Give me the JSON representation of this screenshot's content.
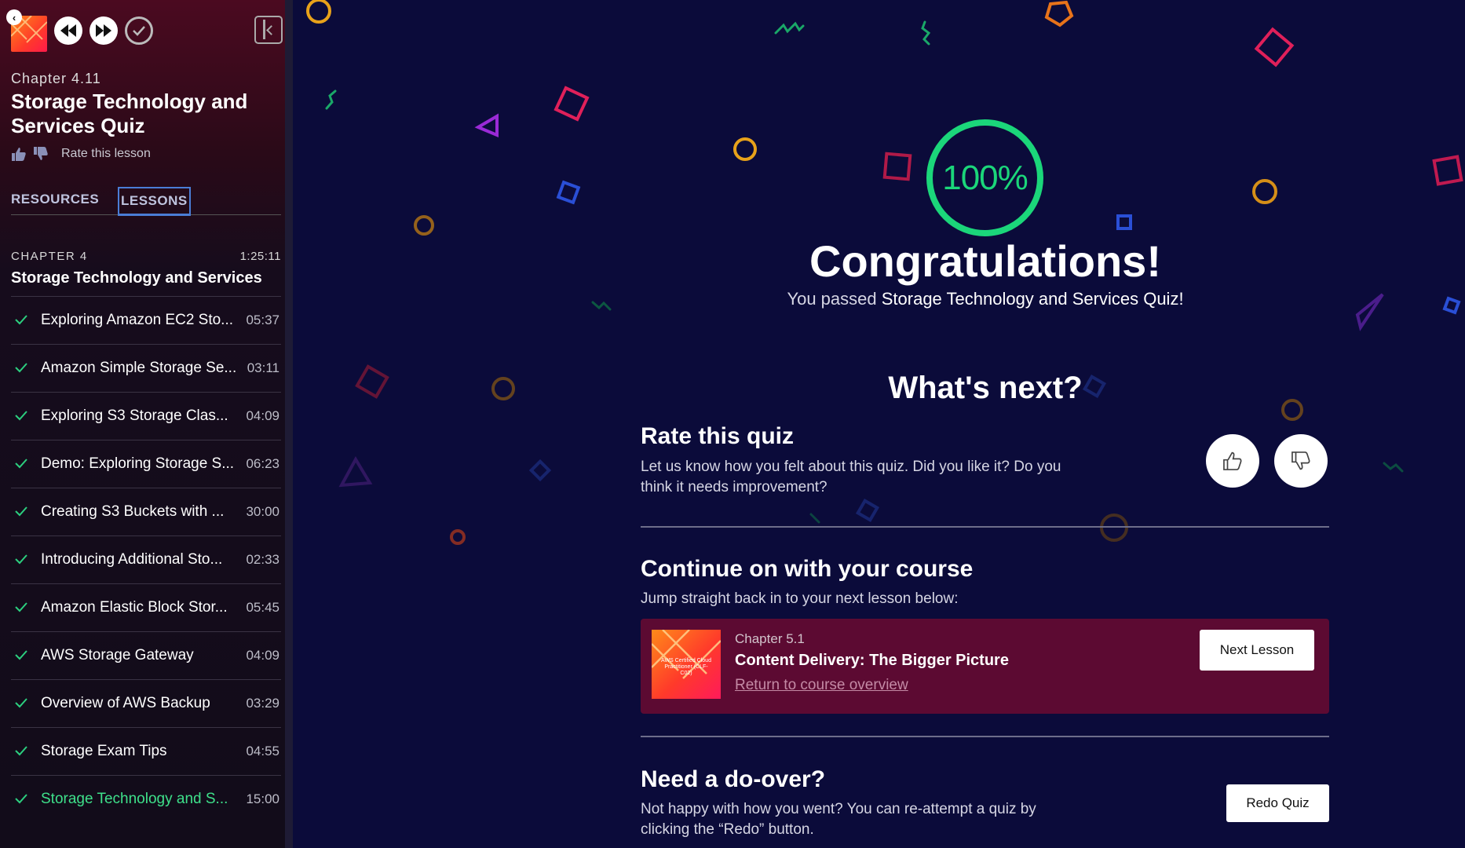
{
  "sidebar": {
    "chapter_label": "Chapter 4.11",
    "lesson_title": "Storage Technology and Services Quiz",
    "rate_text": "Rate this lesson",
    "tabs": {
      "resources": "RESOURCES",
      "lessons": "LESSONS"
    },
    "chapter": {
      "number": "CHAPTER 4",
      "duration": "1:25:11",
      "title": "Storage Technology and Services"
    },
    "lessons": [
      {
        "name": "Exploring Amazon EC2 Sto...",
        "time": "05:37"
      },
      {
        "name": "Amazon Simple Storage Se...",
        "time": "03:11"
      },
      {
        "name": "Exploring S3 Storage Clas...",
        "time": "04:09"
      },
      {
        "name": "Demo: Exploring Storage S...",
        "time": "06:23"
      },
      {
        "name": "Creating S3 Buckets with ...",
        "time": "30:00"
      },
      {
        "name": "Introducing Additional Sto...",
        "time": "02:33"
      },
      {
        "name": "Amazon Elastic Block Stor...",
        "time": "05:45"
      },
      {
        "name": "AWS Storage Gateway",
        "time": "04:09"
      },
      {
        "name": "Overview of AWS Backup",
        "time": "03:29"
      },
      {
        "name": "Storage Exam Tips",
        "time": "04:55"
      },
      {
        "name": "Storage Technology and S...",
        "time": "15:00"
      }
    ]
  },
  "result": {
    "score": "100%",
    "heading": "Congratulations!",
    "passed_prefix": "You passed ",
    "quiz_name": "Storage Technology and Services Quiz!"
  },
  "whats_next": "What's next?",
  "rate_quiz": {
    "title": "Rate this quiz",
    "desc_line1": "Let us know how you felt about this quiz. Did you like it? Do you",
    "desc_line2": "think it needs improvement?"
  },
  "continue": {
    "title": "Continue on with your course",
    "desc": "Jump straight back in to your next lesson below:",
    "next_chapter": "Chapter 5.1",
    "next_title": "Content Delivery: The Bigger Picture",
    "overview_link": "Return to course overview",
    "next_button": "Next Lesson",
    "thumb_text": "AWS Certified Cloud Practitioner (CLF-C02)"
  },
  "redo": {
    "title": "Need a do-over?",
    "desc_line1": "Not happy with how you went? You can re-attempt a quiz by",
    "desc_line2": "clicking the “Redo” button.",
    "button": "Redo Quiz"
  },
  "colors": {
    "background": "#0b0b3a",
    "accent_green": "#1bd67a",
    "card_bg": "#5c0a32",
    "tab_focus": "#4a7dd6"
  }
}
